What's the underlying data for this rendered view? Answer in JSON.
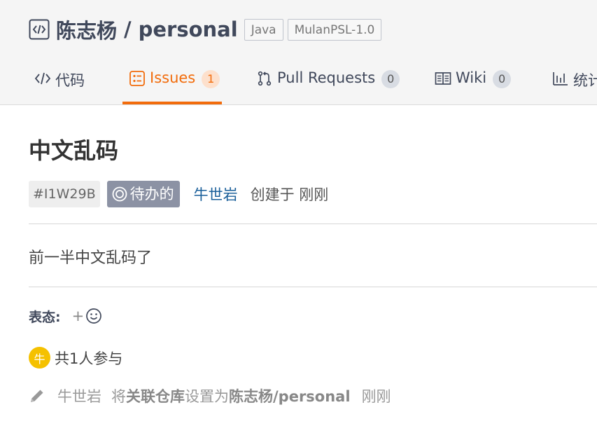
{
  "repo": {
    "owner": "陈志杨",
    "separator": "/",
    "name": "personal",
    "tags": [
      "Java",
      "MulanPSL-1.0"
    ]
  },
  "tabs": [
    {
      "label": "代码",
      "icon": "code-icon"
    },
    {
      "label": "Issues",
      "icon": "issues-icon",
      "count": "1"
    },
    {
      "label": "Pull Requests",
      "icon": "pull-request-icon",
      "count": "0"
    },
    {
      "label": "Wiki",
      "icon": "book-icon",
      "count": "0"
    },
    {
      "label": "统计",
      "icon": "bar-chart-icon"
    }
  ],
  "issue": {
    "title": "中文乱码",
    "ident": "#I1W29B",
    "status": "待办的",
    "author": "牛世岩",
    "created": "创建于 刚刚",
    "body": "前一半中文乱码了"
  },
  "reactions": {
    "label": "表态:",
    "plus": "+"
  },
  "participants": {
    "avatar_text": "牛",
    "text": "共1人参与"
  },
  "activity": {
    "user": "牛世岩",
    "verb": "将",
    "field": "关联仓库",
    "set_to": "设置为",
    "value": "陈志杨/personal",
    "time": "刚刚"
  },
  "colors": {
    "accent": "#f26c0c",
    "status_bg": "#8c92a4",
    "author_link": "#1a5f9a",
    "avatar_bg": "#f5c100"
  }
}
